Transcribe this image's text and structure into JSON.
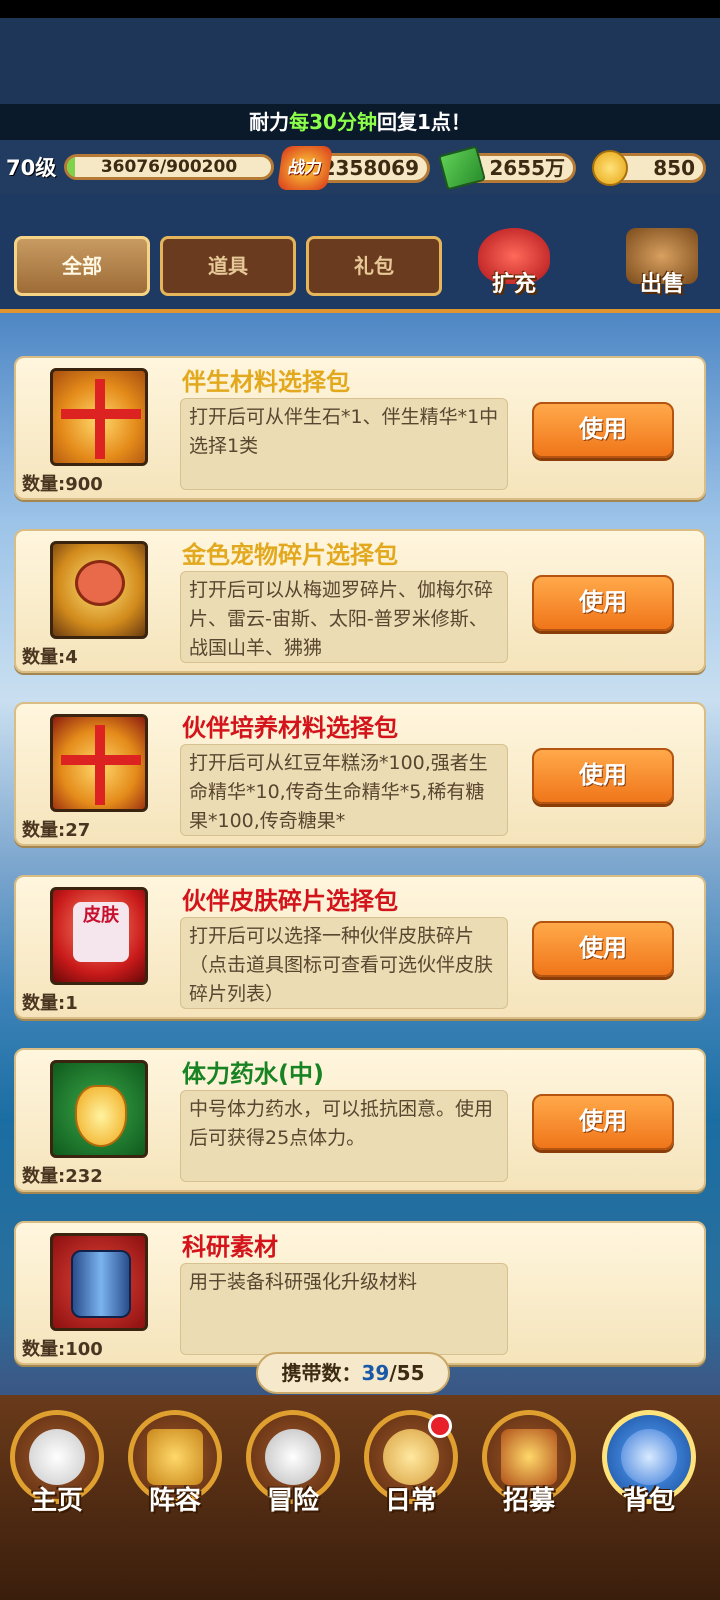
{
  "notice": {
    "pre": "耐力",
    "hl": "每30分钟",
    "post": "回复1点！"
  },
  "resources": {
    "level": "70级",
    "exp_text": "36076/900200",
    "exp_fraction": 0.04,
    "power_badge": "战力",
    "power": "2358069",
    "cash": "2655万",
    "coins": "850"
  },
  "tabs": [
    {
      "label": "全部",
      "active": true
    },
    {
      "label": "道具",
      "active": false
    },
    {
      "label": "礼包",
      "active": false
    }
  ],
  "actions": {
    "expand": "扩充",
    "sell": "出售"
  },
  "items": [
    {
      "title": "伴生材料选择包",
      "title_color": "gold",
      "desc": "打开后可从伴生石*1、伴生精华*1中选择1类",
      "qty": "数量:900",
      "icon": "gift-icon",
      "use": "使用"
    },
    {
      "title": "金色宠物碎片选择包",
      "title_color": "gold",
      "desc": "打开后可以从梅迦罗碎片、伽梅尔碎片、雷云-宙斯、太阳-普罗米修斯、战国山羊、狒狒",
      "qty": "数量:4",
      "icon": "paw-icon",
      "use": "使用"
    },
    {
      "title": "伙伴培养材料选择包",
      "title_color": "red",
      "desc": "打开后可从红豆年糕汤*100,强者生命精华*10,传奇生命精华*5,稀有糖果*100,传奇糖果*",
      "qty": "数量:27",
      "icon": "gift-icon",
      "use": "使用"
    },
    {
      "title": "伙伴皮肤碎片选择包",
      "title_color": "red",
      "desc": "打开后可以选择一种伙伴皮肤碎片（点击道具图标可查看可选伙伴皮肤碎片列表）",
      "qty": "数量:1",
      "icon": "shirt-icon",
      "icon_text": "皮肤",
      "use": "使用"
    },
    {
      "title": "体力药水(中)",
      "title_color": "green",
      "desc": "中号体力药水，可以抵抗困意。使用后可获得25点体力。",
      "qty": "数量:232",
      "icon": "potion-icon",
      "use": "使用"
    },
    {
      "title": "科研素材",
      "title_color": "red",
      "desc": "用于装备科研强化升级材料",
      "qty": "数量:100",
      "icon": "tech-material-icon",
      "use": ""
    }
  ],
  "carry": {
    "label": "携带数：",
    "current": "39",
    "sep": "/",
    "max": "55"
  },
  "nav": [
    {
      "label": "主页",
      "icon": "home-icon",
      "active": false
    },
    {
      "label": "阵容",
      "icon": "lineup-icon",
      "active": false
    },
    {
      "label": "冒险",
      "icon": "skull-icon",
      "active": false
    },
    {
      "label": "日常",
      "icon": "daily-icon",
      "active": false,
      "badge": true
    },
    {
      "label": "招募",
      "icon": "tavern-icon",
      "active": false
    },
    {
      "label": "背包",
      "icon": "bag-icon",
      "active": true
    }
  ]
}
